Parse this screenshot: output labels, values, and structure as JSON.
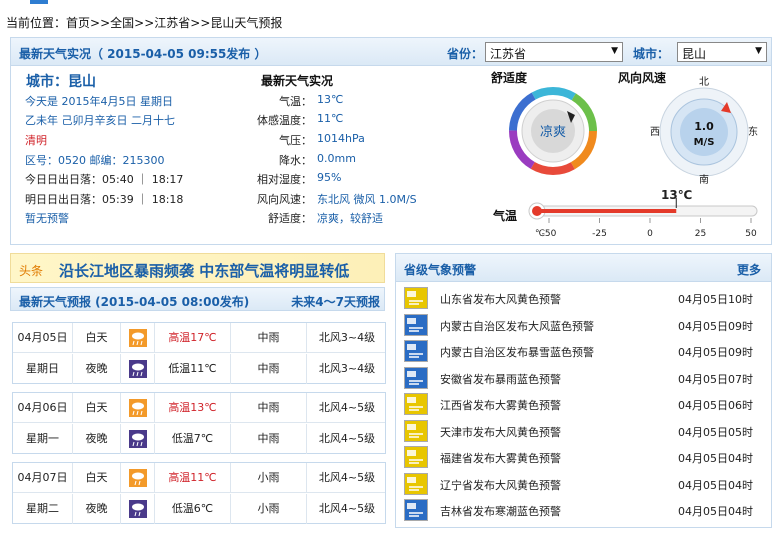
{
  "breadcrumb": {
    "prefix": "当前位置：",
    "home": "首页",
    "sep1": ">>",
    "nation": "全国",
    "sep2": ">>",
    "province": "江苏省",
    "sep3": ">>",
    "current": "昆山天气预报"
  },
  "live": {
    "title": "最新天气实况（ 2015-04-05  09:55发布 ）",
    "province_label": "省份：",
    "province_value": "江苏省",
    "city_label": "城市：",
    "city_value": "昆山",
    "city_heading": "城市：昆山",
    "left_lines": [
      "今天是 2015年4月5日 星期日",
      "乙未年 己卯月辛亥日 二月十七",
      "清明",
      "区号：0520   邮编：215300",
      "今日日出日落：05:40 ｜ 18:17",
      "明日日出日落：05:39 ｜ 18:18",
      "暂无预警"
    ],
    "mid_title": "最新天气实况",
    "mid_rows": [
      {
        "k": "气温：",
        "v": "13℃"
      },
      {
        "k": "体感温度：",
        "v": "11℃"
      },
      {
        "k": "气压：",
        "v": "1014hPa"
      },
      {
        "k": "降水：",
        "v": "0.0mm"
      },
      {
        "k": "相对湿度：",
        "v": "95%"
      },
      {
        "k": "风向风速：",
        "v": "东北风 微风 1.0M/S"
      },
      {
        "k": "舒适度：",
        "v": "凉爽，较舒适"
      }
    ],
    "comfort_title": "舒适度",
    "comfort_value": "凉爽",
    "wind_title": "风向风速",
    "wind_speed": "1.0",
    "wind_unit": "M/S",
    "compass": {
      "n": "北",
      "s": "南",
      "e": "东",
      "w": "西"
    },
    "temp_label": "气温",
    "temp_value": "13℃",
    "temp_unit": "℃",
    "temp_ticks": [
      "-50",
      "-25",
      "0",
      "25",
      "50"
    ],
    "temp_reading": 13,
    "temp_range": [
      -50,
      50
    ]
  },
  "headline": {
    "tag": "头条",
    "title": "沿长江地区暴雨频袭 中东部气温将明显转低"
  },
  "forecast": {
    "title": "最新天气预报 (2015-04-05  08:00发布)",
    "link": "未来4～7天预报",
    "days": [
      {
        "date": "04月05日",
        "weekday": "星期日",
        "day": {
          "period": "白天",
          "temp": "高温17℃",
          "weather": "中雨",
          "wind": "北风3~4级"
        },
        "night": {
          "period": "夜晚",
          "temp": "低温11℃",
          "weather": "中雨",
          "wind": "北风3~4级"
        }
      },
      {
        "date": "04月06日",
        "weekday": "星期一",
        "day": {
          "period": "白天",
          "temp": "高温13℃",
          "weather": "中雨",
          "wind": "北风4~5级"
        },
        "night": {
          "period": "夜晚",
          "temp": "低温7℃",
          "weather": "中雨",
          "wind": "北风4~5级"
        }
      },
      {
        "date": "04月07日",
        "weekday": "星期二",
        "day": {
          "period": "白天",
          "temp": "高温11℃",
          "weather": "小雨",
          "wind": "北风4~5级"
        },
        "night": {
          "period": "夜晚",
          "temp": "低温6℃",
          "weather": "小雨",
          "wind": "北风4~5级"
        }
      }
    ]
  },
  "warnings": {
    "title": "省级气象预警",
    "more": "更多",
    "items": [
      {
        "text": "山东省发布大风黄色预警",
        "date": "04月05日10时",
        "icon": "wind-yellow-icon",
        "color": "#e8c600"
      },
      {
        "text": "内蒙古自治区发布大风蓝色预警",
        "date": "04月05日09时",
        "icon": "wind-blue-icon",
        "color": "#2a6cc4"
      },
      {
        "text": "内蒙古自治区发布暴雪蓝色预警",
        "date": "04月05日09时",
        "icon": "snow-blue-icon",
        "color": "#2a6cc4"
      },
      {
        "text": "安徽省发布暴雨蓝色预警",
        "date": "04月05日07时",
        "icon": "rain-blue-icon",
        "color": "#2a6cc4"
      },
      {
        "text": "江西省发布大雾黄色预警",
        "date": "04月05日06时",
        "icon": "fog-yellow-icon",
        "color": "#e8c600"
      },
      {
        "text": "天津市发布大风黄色预警",
        "date": "04月05日05时",
        "icon": "wind-yellow-icon",
        "color": "#e8c600"
      },
      {
        "text": "福建省发布大雾黄色预警",
        "date": "04月05日04时",
        "icon": "fog-yellow-icon",
        "color": "#e8c600"
      },
      {
        "text": "辽宁省发布大风黄色预警",
        "date": "04月05日04时",
        "icon": "wind-yellow-icon",
        "color": "#e8c600"
      },
      {
        "text": "吉林省发布寒潮蓝色预警",
        "date": "04月05日04时",
        "icon": "coldwave-blue-icon",
        "color": "#2a6cc4"
      }
    ]
  }
}
